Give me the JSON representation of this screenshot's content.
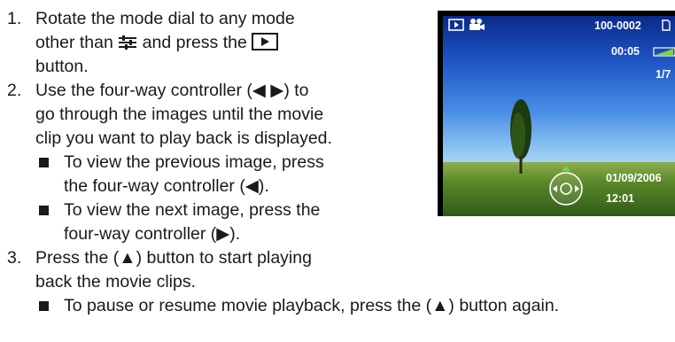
{
  "steps": [
    {
      "number": "1.",
      "line1": "Rotate the mode dial to any mode",
      "line2_before": "other than",
      "line2_middle": "and press the",
      "line3": "button."
    },
    {
      "number": "2.",
      "line1": "Use the four-way controller (◀ ▶) to",
      "line2": "go through the images until the movie",
      "line3": "clip you want to play back is displayed.",
      "bullets": [
        {
          "line1": "To view the previous image, press",
          "line2": "the four-way controller (◀)."
        },
        {
          "line1": "To view the next image, press the",
          "line2": "four-way controller (▶)."
        }
      ]
    },
    {
      "number": "3.",
      "line1": "Press the (▲) button to start playing",
      "line2": "back the movie clips.",
      "bullets": [
        {
          "line1": "To pause or resume movie playback, press the (▲) button again."
        }
      ]
    }
  ],
  "icons": {
    "setup_mode": "setup-mode-icon",
    "playback_button": "playback-button-icon"
  },
  "camera_screen": {
    "file_number": "100-0002",
    "duration": "00:05",
    "frame_count": "1/7",
    "date": "01/09/2006",
    "time": "12:01",
    "osd_color": "#ffffff",
    "battery_color": "#7bd43a"
  }
}
